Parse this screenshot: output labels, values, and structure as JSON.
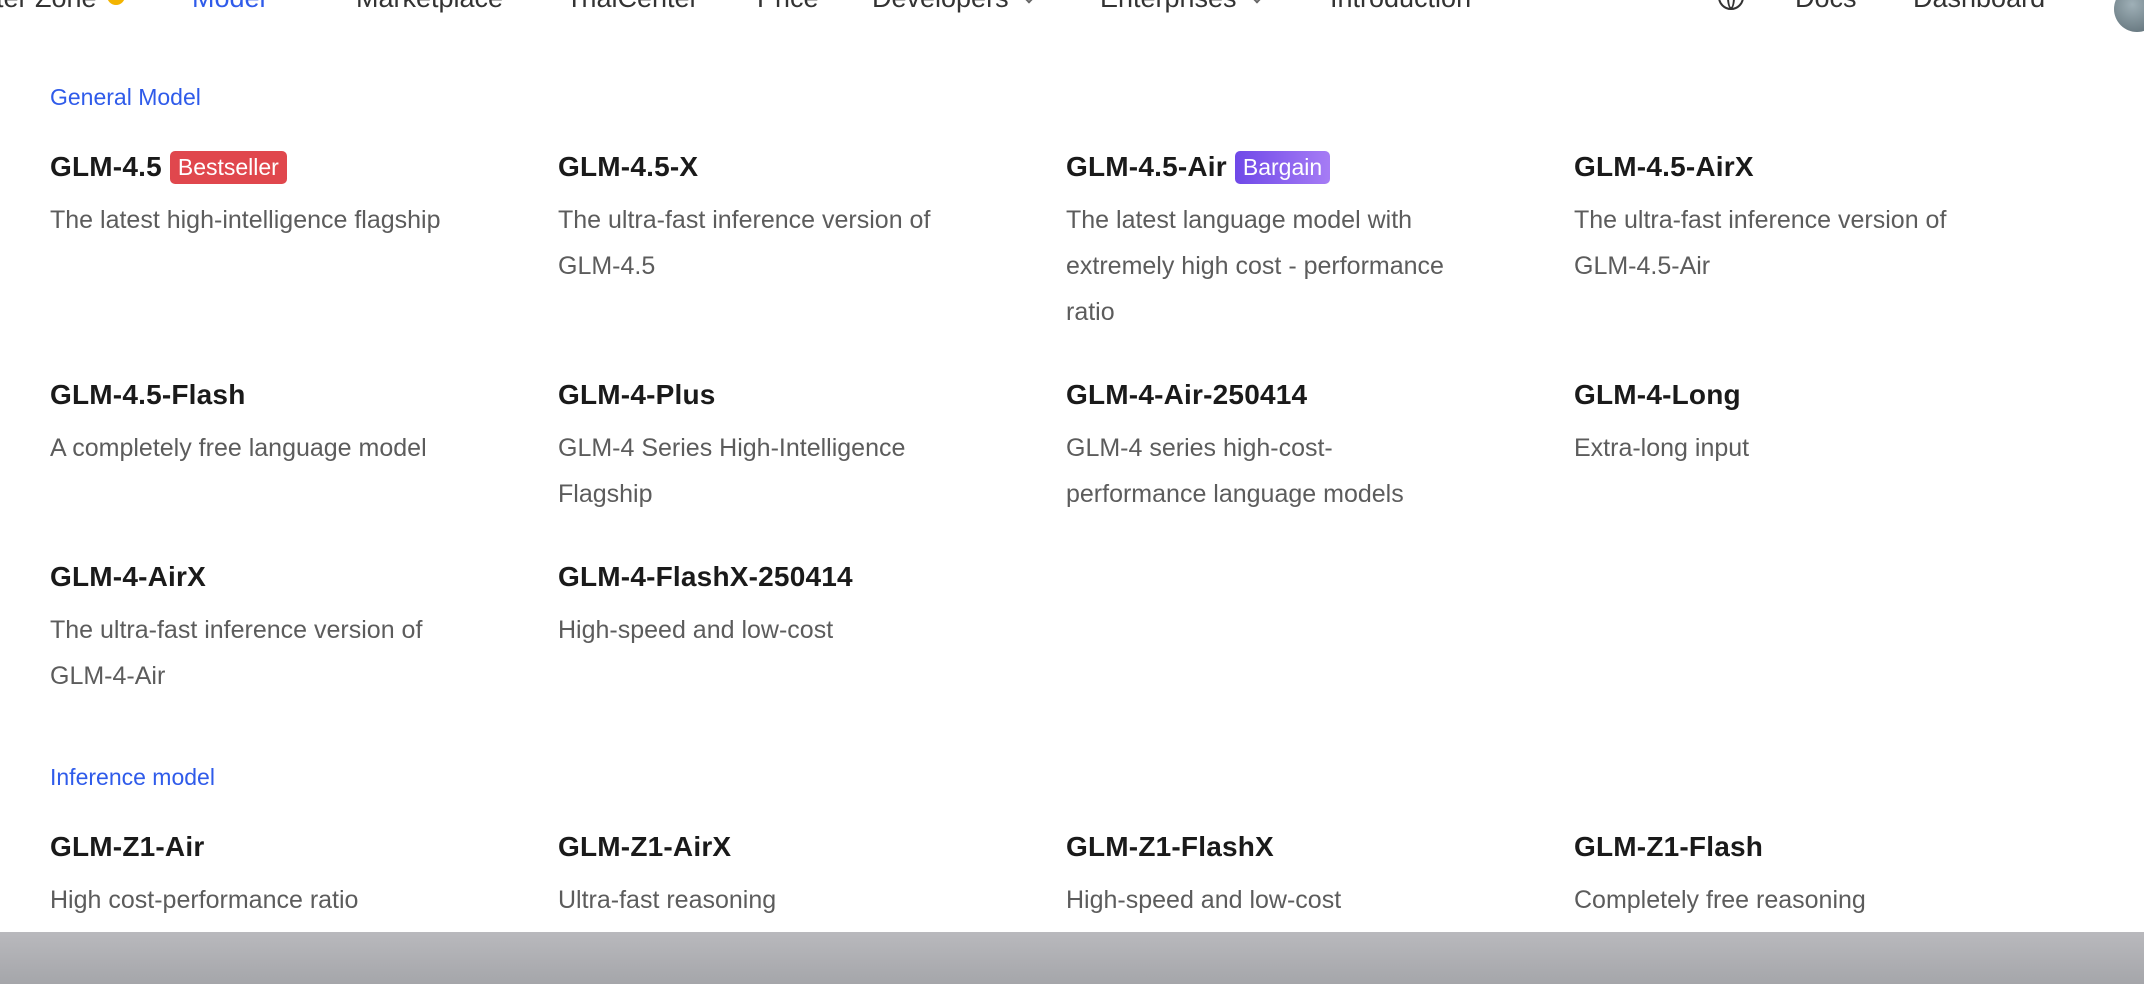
{
  "nav": {
    "items": [
      {
        "label": "ter Zone"
      },
      {
        "label": "Model"
      },
      {
        "label": "Marketplace"
      },
      {
        "label": "TrialCenter"
      },
      {
        "label": "Price"
      },
      {
        "label": "Developers"
      },
      {
        "label": "Enterprises"
      },
      {
        "label": "Introduction"
      }
    ],
    "docs": "Docs",
    "dashboard": "Dashboard",
    "active_color": "#2f5bea"
  },
  "sections": {
    "general": {
      "title": "General Model",
      "models": [
        {
          "name": "GLM-4.5",
          "badge": "Bestseller",
          "badge_color": "#e0474d",
          "desc": "The latest high-intelligence flagship"
        },
        {
          "name": "GLM-4.5-X",
          "desc": "The ultra-fast inference version of GLM-4.5"
        },
        {
          "name": "GLM-4.5-Air",
          "badge": "Bargain",
          "badge_color": "#7a54ec",
          "desc": "The latest language model with extremely high cost - performance ratio"
        },
        {
          "name": "GLM-4.5-AirX",
          "desc": "The ultra-fast inference version of GLM-4.5-Air"
        },
        {
          "name": "GLM-4.5-Flash",
          "desc": "A completely free language model"
        },
        {
          "name": "GLM-4-Plus",
          "desc": "GLM-4 Series High-Intelligence Flagship"
        },
        {
          "name": "GLM-4-Air-250414",
          "desc": "GLM-4 series high-cost-performance language models"
        },
        {
          "name": "GLM-4-Long",
          "desc": "Extra-long input"
        },
        {
          "name": "GLM-4-AirX",
          "desc": "The ultra-fast inference version of GLM-4-Air"
        },
        {
          "name": "GLM-4-FlashX-250414",
          "desc": "High-speed and low-cost"
        }
      ]
    },
    "inference": {
      "title": "Inference model",
      "models": [
        {
          "name": "GLM-Z1-Air",
          "desc": "High cost-performance ratio"
        },
        {
          "name": "GLM-Z1-AirX",
          "desc": "Ultra-fast reasoning"
        },
        {
          "name": "GLM-Z1-FlashX",
          "desc": "High-speed and low-cost"
        },
        {
          "name": "GLM-Z1-Flash",
          "desc": "Completely free reasoning"
        }
      ]
    }
  }
}
